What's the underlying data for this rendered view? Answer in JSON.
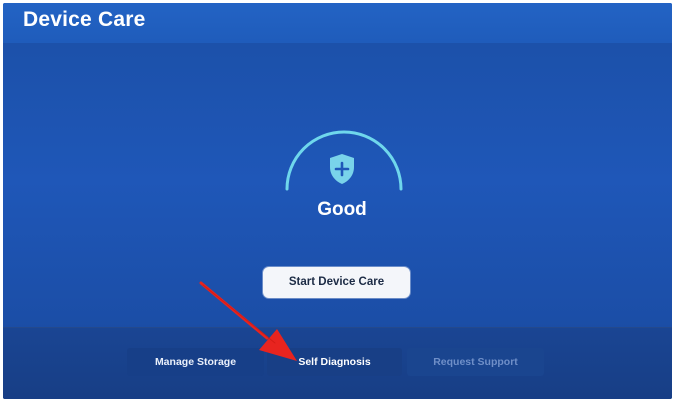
{
  "header": {
    "title": "Device Care"
  },
  "status": {
    "label": "Good",
    "icon": "shield-plus-icon"
  },
  "main": {
    "start_button_label": "Start Device Care"
  },
  "tabs": [
    {
      "label": "Manage Storage",
      "state": "normal"
    },
    {
      "label": "Self Diagnosis",
      "state": "highlighted"
    },
    {
      "label": "Request Support",
      "state": "disabled"
    }
  ],
  "annotation": {
    "arrow_color": "#e8241f",
    "points_to": "Self Diagnosis"
  },
  "colors": {
    "background": "#1f57b8",
    "accent_gauge": "#6fd7ec",
    "text": "#ffffff"
  }
}
